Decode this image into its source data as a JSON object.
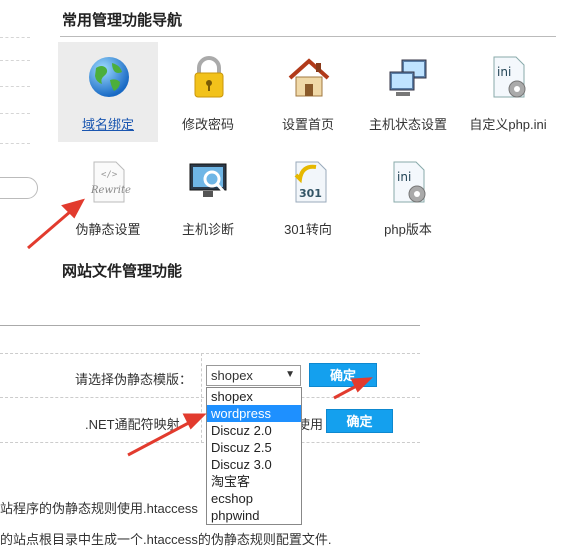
{
  "nav": {
    "title": "常用管理功能导航",
    "tiles": [
      {
        "label": "域名绑定",
        "icon": "globe-icon",
        "selected": true
      },
      {
        "label": "修改密码",
        "icon": "padlock-icon"
      },
      {
        "label": "设置首页",
        "icon": "house-icon"
      },
      {
        "label": "主机状态设置",
        "icon": "computers-icon"
      },
      {
        "label": "自定义php.ini",
        "icon": "ini-file-icon"
      },
      {
        "label": "伪静态设置",
        "icon": "rewrite-file-icon"
      },
      {
        "label": "主机诊断",
        "icon": "monitor-magnifier-icon"
      },
      {
        "label": "301转向",
        "icon": "301-redirect-icon"
      },
      {
        "label": "php版本",
        "icon": "ini-file-gear-icon"
      }
    ]
  },
  "file_section": {
    "title": "网站文件管理功能"
  },
  "rewrite_form": {
    "template_label": "请选择伪静态模版：",
    "selected_value": "shopex",
    "confirm_label": "确定",
    "net_label": ".NET通配符映射",
    "net_trailing": "使用",
    "net_confirm_label": "确定",
    "options": [
      "shopex",
      "wordpress",
      "Discuz 2.0",
      "Discuz 2.5",
      "Discuz 3.0",
      "淘宝客",
      "ecshop",
      "phpwind"
    ],
    "highlighted_option": "wordpress"
  },
  "notes": {
    "line1": "站程序的伪静态规则使用.htaccess",
    "line2": "的站点根目录中生成一个.htaccess的伪静态规则配置文件."
  },
  "colors": {
    "accent_button": "#14a0ee",
    "annotation_arrow": "#e23b2e",
    "highlight": "#1e90ff"
  }
}
